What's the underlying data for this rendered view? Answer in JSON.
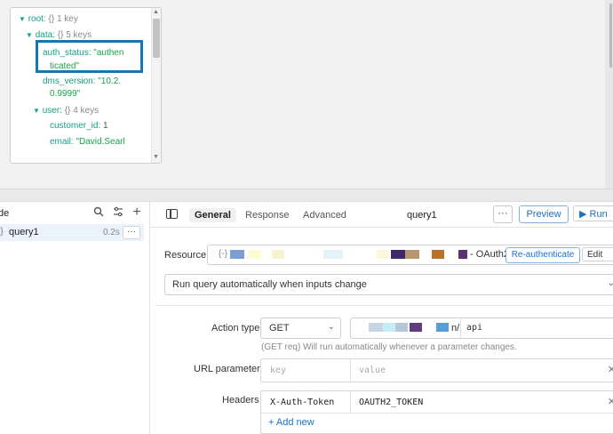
{
  "json_explorer": {
    "root_key": "root:",
    "root_type": "{}",
    "root_count": "1 key",
    "data_key": "data:",
    "data_type": "{}",
    "data_count": "5 keys",
    "auth_status_key": "auth_status:",
    "auth_status_val_1": "\"authen",
    "auth_status_val_2": "ticated\"",
    "dms_version_key": "dms_version:",
    "dms_version_val_1": "\"10.2.",
    "dms_version_val_2": "0.9999\"",
    "user_key": "user:",
    "user_type": "{}",
    "user_count": "4 keys",
    "customer_id_key": "customer_id:",
    "customer_id_val": "1",
    "email_key": "email:",
    "email_val": "\"David.Searl"
  },
  "query_list": {
    "title": "de",
    "query_name": "query1",
    "query_time": "0.2s",
    "more_label": "···"
  },
  "toolbar": {
    "tabs": [
      "General",
      "Response",
      "Advanced"
    ],
    "query_name": "query1",
    "more_label": "···",
    "preview_label": "Preview",
    "run_label": "▶ Run"
  },
  "resource": {
    "label": "Resource",
    "brace": "{-}",
    "suffix": "- OAuth2",
    "reauth_label": "Re-authenticate",
    "edit_label": "Edit",
    "redaction_colors": [
      "#7d9fd1",
      "#fffbd5",
      "#f6f3d0",
      "#e6f2fa",
      "#fbf6dc",
      "#3c2b6b",
      "#b89870",
      "#b7732c",
      "#5a3472"
    ]
  },
  "run_mode": {
    "label": "Run query automatically when inputs change"
  },
  "action": {
    "label": "Action type",
    "method": "GET",
    "url_suffix": "n/",
    "url_path": "api",
    "url_redaction_colors": [
      "#c8d4e4",
      "#c6ecf7",
      "#b5c7dc",
      "#5e3c82",
      "#5b9dd8"
    ],
    "hint": "(GET req) Will run automatically whenever a parameter changes."
  },
  "url_params": {
    "label": "URL parameters",
    "key_placeholder": "key",
    "value_placeholder": "value"
  },
  "headers": {
    "label": "Headers",
    "key": "X-Auth-Token",
    "value": "OAUTH2_TOKEN",
    "add_label": "+ Add new"
  }
}
